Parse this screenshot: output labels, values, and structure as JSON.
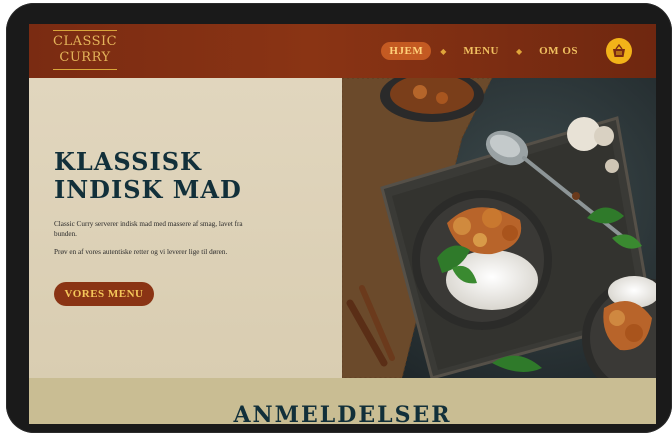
{
  "logo": {
    "line1": "CLASSIC",
    "line2": "CURRY"
  },
  "nav": {
    "items": [
      "HJEM",
      "MENU",
      "OM OS"
    ],
    "active": "HJEM"
  },
  "hero": {
    "title_line1": "KLASSISK",
    "title_line2": "INDISK MAD",
    "paragraph1": "Classic Curry serverer indisk mad med massere af smag, lavet fra bunden.",
    "paragraph2": "Prøv en af vores autentiske retter og vi leverer lige til døren.",
    "cta_label": "VORES MENU"
  },
  "reviews": {
    "title": "ANMELDELSER"
  },
  "colors": {
    "header": "#8a3414",
    "accent": "#f2b319",
    "title": "#12303a",
    "cream": "#e1d6be"
  },
  "icons": {
    "cart": "basket-icon"
  }
}
